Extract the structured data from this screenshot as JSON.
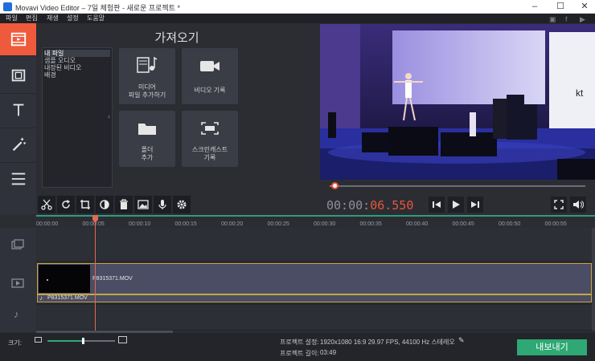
{
  "window": {
    "title": "Movavi Video Editor – 7일 체험판 - 새로운 프로젝트 *"
  },
  "menu": {
    "items": [
      "파일",
      "편집",
      "재생",
      "설정",
      "도움말"
    ]
  },
  "import": {
    "title": "가져오기",
    "files": [
      "내 파일",
      "샘플 오디오",
      "내장된 비디오",
      "배경"
    ],
    "tiles": [
      {
        "l1": "미디어",
        "l2": "파일 추가하기"
      },
      {
        "l1": "비디오 기록",
        "l2": ""
      },
      {
        "l1": "폴더",
        "l2": "추가"
      },
      {
        "l1": "스크린캐스트",
        "l2": "기록"
      }
    ]
  },
  "player": {
    "timecode_gray": "00:00:",
    "timecode_red": "06.550",
    "seek_fraction": 0.02
  },
  "timeline": {
    "ticks": [
      "00:00:00",
      "00:00:05",
      "00:00:10",
      "00:00:15",
      "00:00:20",
      "00:00:25",
      "00:00:30",
      "00:00:35",
      "00:00:40",
      "00:00:45",
      "00:00:50",
      "00:00:55"
    ],
    "video_clip": "P8315371.MOV",
    "audio_clip": "P8315371.MOV"
  },
  "bottom": {
    "scale_label": "크기:",
    "zoom_fraction": 0.52,
    "settings_label": "프로젝트 설정:",
    "settings_value": "1920x1080 16:9 29.97 FPS, 44100 Hz 스테레오",
    "length_label": "프로젝트 길이:",
    "length_value": "03:49",
    "export_label": "내보내기"
  },
  "colors": {
    "accent": "#f05a3c",
    "export": "#2ea874",
    "timecode_red": "#e8553b",
    "clip_border": "#c9a545"
  }
}
